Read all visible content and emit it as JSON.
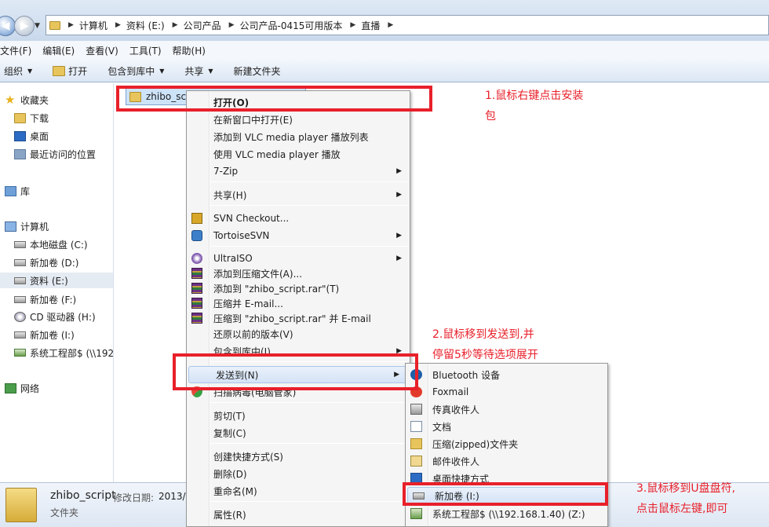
{
  "address": {
    "crumbs": [
      "计算机",
      "资料 (E:)",
      "公司产品",
      "公司产品-0415可用版本",
      "直播"
    ]
  },
  "menubar": [
    "文件(F)",
    "编辑(E)",
    "查看(V)",
    "工具(T)",
    "帮助(H)"
  ],
  "toolbar": {
    "organize": "组织",
    "open": "打开",
    "include_in_library": "包含到库中",
    "share": "共享",
    "new_folder": "新建文件夹"
  },
  "nav": {
    "favorites": "收藏夹",
    "downloads": "下载",
    "desktop": "桌面",
    "recent": "最近访问的位置",
    "libraries": "库",
    "computer": "计算机",
    "local_c": "本地磁盘 (C:)",
    "new_d": "新加卷 (D:)",
    "data_e": "资料 (E:)",
    "new_f": "新加卷 (F:)",
    "cd_h": "CD 驱动器 (H:)",
    "new_i": "新加卷 (I:)",
    "net_drive": "系统工程部$ (\\\\192",
    "network": "网络"
  },
  "file": {
    "name": "zhibo_scri"
  },
  "details": {
    "name": "zhibo_script",
    "modified_label": "修改日期:",
    "modified_value": "2013/4",
    "type": "文件夹"
  },
  "context_menu": {
    "open": "打开(O)",
    "open_new_window": "在新窗口中打开(E)",
    "vlc_add_playlist": "添加到 VLC media player 播放列表",
    "vlc_play": "使用 VLC media player 播放",
    "seven_zip": "7-Zip",
    "share": "共享(H)",
    "svn_checkout": "SVN Checkout...",
    "tortoise_svn": "TortoiseSVN",
    "ultraiso": "UltraISO",
    "add_to_archive": "添加到压缩文件(A)...",
    "add_to_rar": "添加到 \"zhibo_script.rar\"(T)",
    "compress_email": "压缩并 E-mail...",
    "compress_rar_email": "压缩到 \"zhibo_script.rar\" 并 E-mail",
    "restore_previous": "还原以前的版本(V)",
    "include_library": "包含到库中(I)",
    "send_to": "发送到(N)",
    "scan_virus": "扫描病毒(电脑管家)",
    "cut": "剪切(T)",
    "copy": "复制(C)",
    "create_shortcut": "创建快捷方式(S)",
    "delete": "删除(D)",
    "rename": "重命名(M)",
    "properties": "属性(R)"
  },
  "send_to_menu": {
    "bluetooth": "Bluetooth 设备",
    "foxmail": "Foxmail",
    "fax": "传真收件人",
    "documents": "文档",
    "zip": "压缩(zipped)文件夹",
    "mail": "邮件收件人",
    "desktop_shortcut": "桌面快捷方式",
    "new_volume_i": "新加卷 (I:)",
    "net_drive_z": "系统工程部$ (\\\\192.168.1.40) (Z:)"
  },
  "annotations": {
    "step1_line1": "1.鼠标右键点击安装",
    "step1_line2": "包",
    "step2_line1": "2.鼠标移到发送到,并",
    "step2_line2": "停留5秒等待选项展开",
    "step3_line1": "3.鼠标移到U盘盘符,",
    "step3_line2": "点击鼠标左键,即可"
  },
  "colors": {
    "annotation_red": "#e8202a",
    "highlight_blue": "#d4e3f6"
  }
}
